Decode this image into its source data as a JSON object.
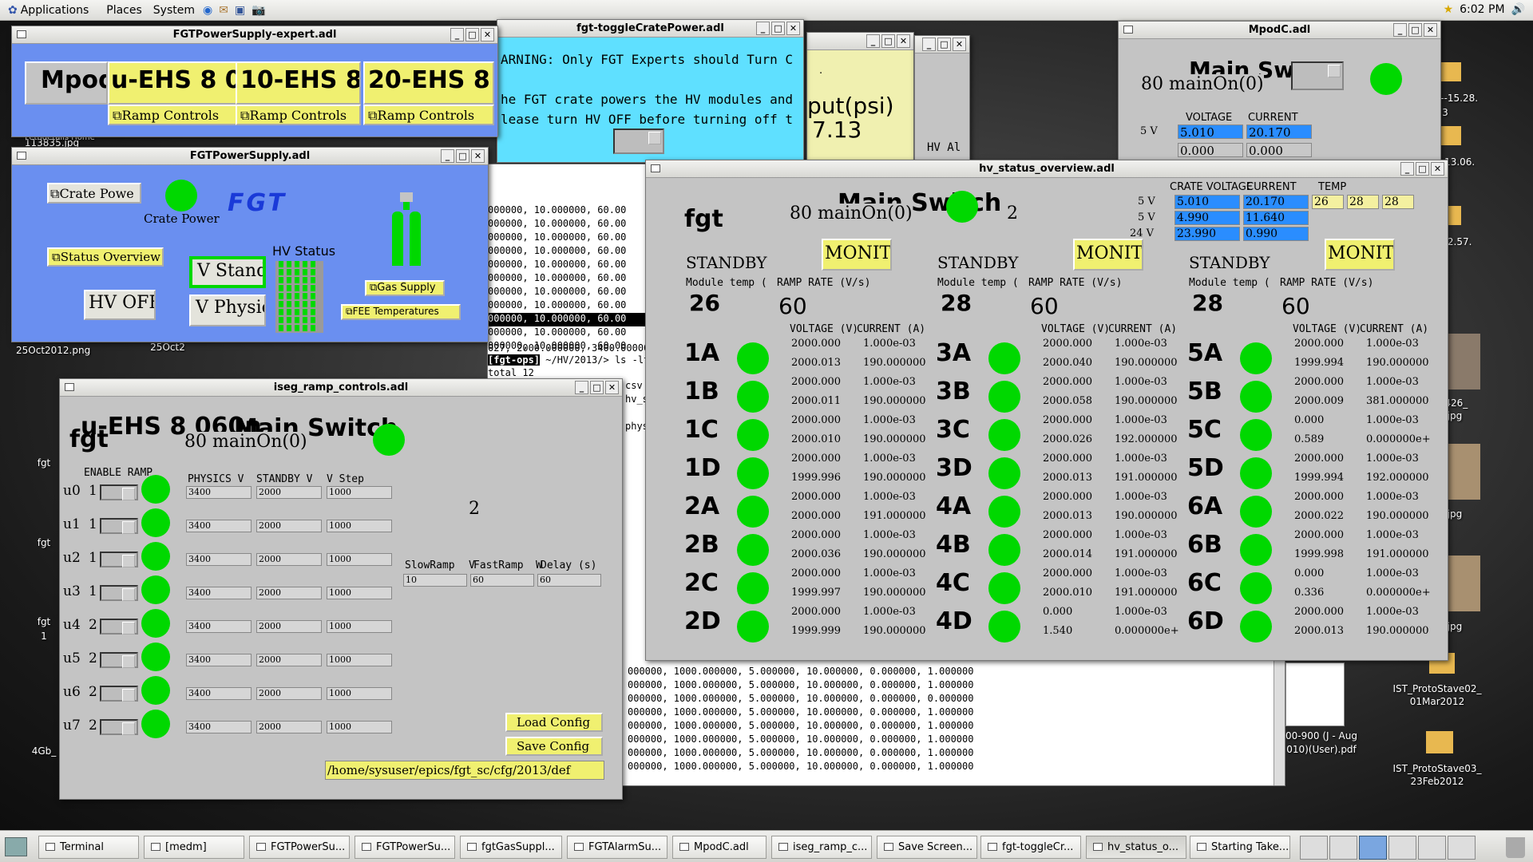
{
  "panel": {
    "menus": [
      "Applications",
      "Places",
      "System"
    ],
    "clock": "6:02 PM"
  },
  "colors": {
    "led": "#00d800",
    "fgt_blue": "#6a8ff0",
    "cyan": "#5fe0ff",
    "field_blue": "#2a8dff",
    "bg_grey": "#c4c4c4"
  },
  "desktop": {
    "icons": [
      "113835.jpg",
      "25Oct2012.png",
      "25Oct2",
      "fgt",
      "fgt",
      "fgt",
      "1",
      "4Gb_",
      "07--15.28.",
      "3",
      "3--13.06.",
      "--12.57.",
      "0426_",
      ".jpg",
      ".jpg",
      ".jpg",
      "IST_ProtoStave02_",
      "01Mar2012",
      "IST_ProtoStave03_",
      "23Feb2012",
      "00-900 (J - Aug",
      "010)(User).pdf",
      "Fethdetails Home"
    ]
  },
  "expert": {
    "title": "FGTPowerSupply-expert.adl",
    "mpod": "Mpod",
    "ehs": [
      "u-EHS 8 0",
      "10-EHS 8",
      "20-EHS 8"
    ],
    "ramp": "Ramp Controls"
  },
  "fgtps": {
    "title": "FGTPowerSupply.adl",
    "crate_btn": "Crate Powe",
    "crate_lbl": "Crate Power",
    "logo": "FGT",
    "status_btn": "Status Overview",
    "hv_off": "HV OFF",
    "hv_status": "HV Status",
    "standby": "V Standl",
    "physics": "V Physic",
    "gas": "Gas Supply",
    "fee": "FEE Temperatures"
  },
  "toggle": {
    "title": "fgt-toggleCratePower.adl",
    "l1": "ARNING: Only FGT Experts should Turn C",
    "l2": "he FGT crate powers the HV modules and",
    "l3": "lease turn HV OFF before turning off t"
  },
  "gas": {
    "l1": "put(psi)",
    "l2": "7.13",
    "dot": "."
  },
  "alarm": {
    "l1": "HV Al"
  },
  "mpodc": {
    "title": "MpodC.adl",
    "main": "Main Sw",
    "mainon": "80 mainOn(0)",
    "voltage": "VOLTAGE",
    "current": "CURRENT",
    "rows": [
      {
        "lbl": "5 V",
        "v": "5.010",
        "c": "20.170"
      },
      {
        "lbl": "",
        "v": "0.000",
        "c": "0.000"
      }
    ]
  },
  "terminal": {
    "prompt_tag": "[fgt-ops]",
    "prompt": " ~/HV/2013/> ls -ltr",
    "total": "total 12",
    "top_lines": [
      "000000, 10.000000, 60.00",
      "000000, 10.000000, 60.00",
      "000000, 10.000000, 60.00",
      "000000, 10.000000, 60.00",
      "000000, 10.000000, 60.00",
      "000000, 10.000000, 60.00",
      "000000, 10.000000, 60.00",
      "000000, 10.000000, 60.00",
      "000000, 10.000000, 60.00",
      "000000, 10.000000, 60.00",
      "000000, 10.000000, 60.00"
    ],
    "pre_prompt": "027, 2000.000000, 3400.000000, 0.001000, 10.000000, 60.00",
    "side": [
      "csv",
      "hv_s",
      "",
      "phys",
      "",
      "",
      "",
      "",
      "",
      "",
      "",
      "",
      "",
      "",
      ""
    ],
    "bottom_lines": [
      "000000, 1000.000000, 5.000000, 10.000000, 0.000000, 1.000000",
      "000000, 1000.000000, 5.000000, 10.000000, 0.000000, 1.000000",
      "000000, 1000.000000, 5.000000, 10.000000, 0.000000, 0.000000",
      "000000, 1000.000000, 5.000000, 10.000000, 0.000000, 1.000000",
      "000000, 1000.000000, 5.000000, 10.000000, 0.000000, 1.000000",
      "000000, 1000.000000, 5.000000, 10.000000, 0.000000, 1.000000",
      "000000, 1000.000000, 5.000000, 10.000000, 0.000000, 1.000000",
      "000000, 1000.000000, 5.000000, 10.000000, 0.000000, 1.000000"
    ]
  },
  "iseg": {
    "title": "iseg_ramp_controls.adl",
    "header": "u-EHS 8 060n",
    "main": "Main Switch",
    "fgt": "fgt",
    "mainon": "80 mainOn(0)",
    "enable": "ENABLE RAMP",
    "cols": [
      "PHYSICS V",
      "STANDBY V",
      "V Step"
    ],
    "two": "2",
    "slow": "SlowRamp",
    "fast": "FastRamp",
    "delay": "Delay (s)",
    "vV": "V",
    "vW": "W",
    "slow_v": "10",
    "fast_v": "60",
    "delay_v": "60",
    "rows": [
      {
        "ch": "u0",
        "n": "1",
        "p": "3400",
        "s": "2000",
        "st": "1000"
      },
      {
        "ch": "u1",
        "n": "1",
        "p": "3400",
        "s": "2000",
        "st": "1000"
      },
      {
        "ch": "u2",
        "n": "1",
        "p": "3400",
        "s": "2000",
        "st": "1000"
      },
      {
        "ch": "u3",
        "n": "1",
        "p": "3400",
        "s": "2000",
        "st": "1000"
      },
      {
        "ch": "u4",
        "n": "2",
        "p": "3400",
        "s": "2000",
        "st": "1000"
      },
      {
        "ch": "u5",
        "n": "2",
        "p": "3400",
        "s": "2000",
        "st": "1000"
      },
      {
        "ch": "u6",
        "n": "2",
        "p": "3400",
        "s": "2000",
        "st": "1000"
      },
      {
        "ch": "u7",
        "n": "2",
        "p": "3400",
        "s": "2000",
        "st": "1000"
      }
    ],
    "load": "Load Config",
    "save": "Save Config",
    "path": "/home/sysuser/epics/fgt_sc/cfg/2013/def"
  },
  "hv": {
    "title": "hv_status_overview.adl",
    "main": "Main Switch",
    "fgt": "fgt",
    "mainon": "80 mainOn(0)",
    "two": "2",
    "crate_voltage": "CRATE VOLTAGE",
    "current": "CURRENT",
    "temp": "TEMP",
    "crate": [
      {
        "lbl": "5 V",
        "v": "5.010",
        "c": "20.170"
      },
      {
        "lbl": "5 V",
        "v": "4.990",
        "c": "11.640"
      },
      {
        "lbl": "24 V",
        "v": "23.990",
        "c": "0.990"
      }
    ],
    "temps": [
      "26",
      "28",
      "28"
    ],
    "standby": "STANDBY",
    "monitor": "MONIT",
    "module_temp": "Module temp (",
    "ramp_rate": "RAMP RATE (V/s)",
    "volt_hdr": "VOLTAGE (V)",
    "curr_hdr": "CURRENT (A)",
    "modules": [
      {
        "temp": "26",
        "rate": "60",
        "ch": [
          {
            "n": "1A",
            "v1": "2000.000",
            "c1": "1.000e-03",
            "v2": "2000.013",
            "c2": "190.000000"
          },
          {
            "n": "1B",
            "v1": "2000.000",
            "c1": "1.000e-03",
            "v2": "2000.011",
            "c2": "190.000000"
          },
          {
            "n": "1C",
            "v1": "2000.000",
            "c1": "1.000e-03",
            "v2": "2000.010",
            "c2": "190.000000"
          },
          {
            "n": "1D",
            "v1": "2000.000",
            "c1": "1.000e-03",
            "v2": "1999.996",
            "c2": "190.000000"
          },
          {
            "n": "2A",
            "v1": "2000.000",
            "c1": "1.000e-03",
            "v2": "2000.000",
            "c2": "191.000000"
          },
          {
            "n": "2B",
            "v1": "2000.000",
            "c1": "1.000e-03",
            "v2": "2000.036",
            "c2": "190.000000"
          },
          {
            "n": "2C",
            "v1": "2000.000",
            "c1": "1.000e-03",
            "v2": "1999.997",
            "c2": "190.000000"
          },
          {
            "n": "2D",
            "v1": "2000.000",
            "c1": "1.000e-03",
            "v2": "1999.999",
            "c2": "190.000000"
          }
        ]
      },
      {
        "temp": "28",
        "rate": "60",
        "ch": [
          {
            "n": "3A",
            "v1": "2000.000",
            "c1": "1.000e-03",
            "v2": "2000.040",
            "c2": "190.000000"
          },
          {
            "n": "3B",
            "v1": "2000.000",
            "c1": "1.000e-03",
            "v2": "2000.058",
            "c2": "190.000000"
          },
          {
            "n": "3C",
            "v1": "2000.000",
            "c1": "1.000e-03",
            "v2": "2000.026",
            "c2": "192.000000"
          },
          {
            "n": "3D",
            "v1": "2000.000",
            "c1": "1.000e-03",
            "v2": "2000.013",
            "c2": "191.000000"
          },
          {
            "n": "4A",
            "v1": "2000.000",
            "c1": "1.000e-03",
            "v2": "2000.013",
            "c2": "190.000000"
          },
          {
            "n": "4B",
            "v1": "2000.000",
            "c1": "1.000e-03",
            "v2": "2000.014",
            "c2": "191.000000"
          },
          {
            "n": "4C",
            "v1": "2000.000",
            "c1": "1.000e-03",
            "v2": "2000.010",
            "c2": "191.000000"
          },
          {
            "n": "4D",
            "v1": "0.000",
            "c1": "1.000e-03",
            "v2": "1.540",
            "c2": "0.000000e+"
          }
        ]
      },
      {
        "temp": "28",
        "rate": "60",
        "ch": [
          {
            "n": "5A",
            "v1": "2000.000",
            "c1": "1.000e-03",
            "v2": "1999.994",
            "c2": "190.000000"
          },
          {
            "n": "5B",
            "v1": "2000.000",
            "c1": "1.000e-03",
            "v2": "2000.009",
            "c2": "381.000000"
          },
          {
            "n": "5C",
            "v1": "0.000",
            "c1": "1.000e-03",
            "v2": "0.589",
            "c2": "0.000000e+"
          },
          {
            "n": "5D",
            "v1": "2000.000",
            "c1": "1.000e-03",
            "v2": "1999.994",
            "c2": "192.000000"
          },
          {
            "n": "6A",
            "v1": "2000.000",
            "c1": "1.000e-03",
            "v2": "2000.022",
            "c2": "190.000000"
          },
          {
            "n": "6B",
            "v1": "2000.000",
            "c1": "1.000e-03",
            "v2": "1999.998",
            "c2": "191.000000"
          },
          {
            "n": "6C",
            "v1": "0.000",
            "c1": "1.000e-03",
            "v2": "0.336",
            "c2": "0.000000e+"
          },
          {
            "n": "6D",
            "v1": "2000.000",
            "c1": "1.000e-03",
            "v2": "2000.013",
            "c2": "190.000000"
          }
        ]
      }
    ]
  },
  "taskbar": {
    "items": [
      "Terminal",
      "[medm]",
      "FGTPowerSu...",
      "FGTPowerSu...",
      "fgtGasSuppl...",
      "FGTAlarmSu...",
      "MpodC.adl",
      "iseg_ramp_c...",
      "Save Screen...",
      "fgt-toggleCr...",
      "hv_status_o...",
      "Starting Take..."
    ]
  }
}
